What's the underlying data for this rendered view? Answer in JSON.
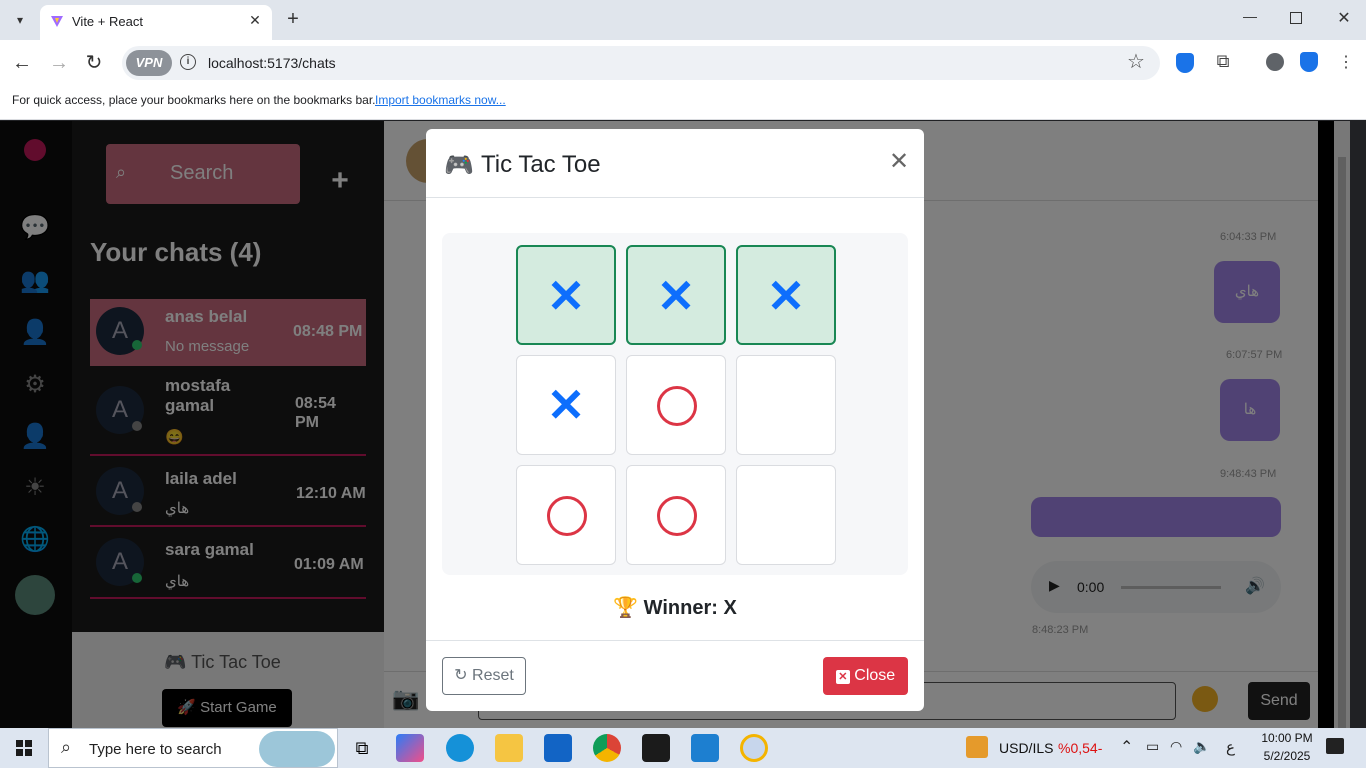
{
  "browser": {
    "tab_title": "Vite + React",
    "url": "localhost:5173/chats",
    "vpn_label": "VPN",
    "bookmarks_text": "For quick access, place your bookmarks here on the bookmarks bar.",
    "bookmarks_link": "Import bookmarks now..."
  },
  "sidebar": {
    "search_placeholder": "Search",
    "heading": "Your chats (4)",
    "chats": [
      {
        "name": "anas belal",
        "message": "No message",
        "time": "08:48 PM",
        "avatar": "A",
        "online": true,
        "active": true
      },
      {
        "name": "mostafa gamal",
        "message": "😄",
        "time": "08:54 PM",
        "avatar": "A",
        "online": false,
        "active": false
      },
      {
        "name": "laila adel",
        "message": "هاي",
        "time": "12:10 AM",
        "avatar": "A",
        "online": false,
        "active": false
      },
      {
        "name": "sara gamal",
        "message": "هاي",
        "time": "01:09 AM",
        "avatar": "A",
        "online": true,
        "active": false
      }
    ],
    "game_label": "🎮 Tic Tac Toe",
    "start_game": "🚀 Start Game"
  },
  "chat": {
    "messages": [
      {
        "time": "6:04:33 PM",
        "text": "هاي"
      },
      {
        "time": "6:07:57 PM",
        "text": "ها"
      },
      {
        "time": "9:48:43 PM",
        "text": ""
      }
    ],
    "audio_time": "0:00",
    "audio_timestamp": "8:48:23 PM",
    "send_label": "Send"
  },
  "modal": {
    "title": "Tic Tac Toe",
    "board": [
      [
        "X",
        "X",
        "X"
      ],
      [
        "X",
        "O",
        ""
      ],
      [
        "O",
        "O",
        ""
      ]
    ],
    "winning_cells": [
      0,
      1,
      2
    ],
    "winner_text": "Winner: X",
    "reset_label": "Reset",
    "close_label": "Close"
  },
  "taskbar": {
    "search_placeholder": "Type here to search",
    "ticker": "USD/ILS",
    "ticker_value": "%0,54-",
    "lang": "ع",
    "time": "10:00 PM",
    "date": "5/2/2025"
  }
}
